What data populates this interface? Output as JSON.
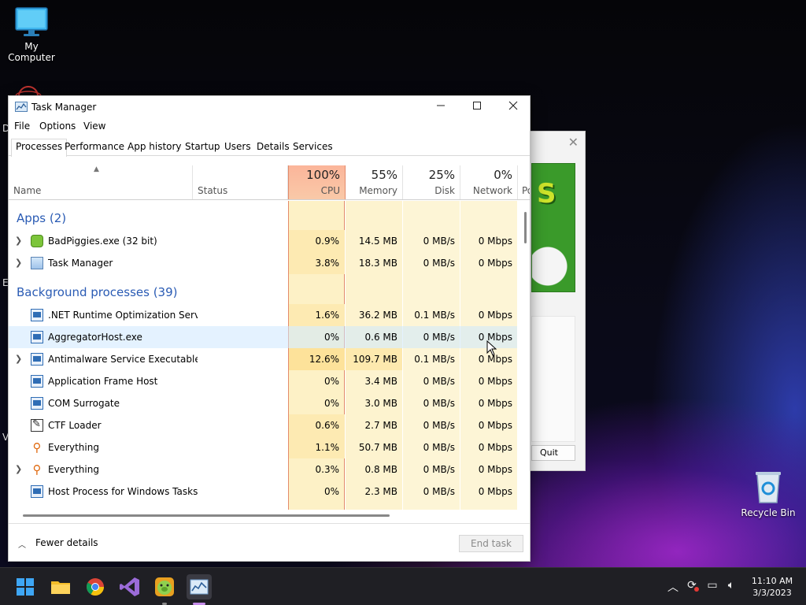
{
  "desktop": {
    "icons": {
      "my_computer": "My Computer",
      "recycle_bin": "Recycle Bin"
    },
    "partial_letters": {
      "d": "D",
      "e": "E",
      "v": "V"
    }
  },
  "background_dialog": {
    "quit_label": "Quit",
    "art_text": "S"
  },
  "window": {
    "title": "Task Manager",
    "menu": [
      "File",
      "Options",
      "View"
    ],
    "tabs": [
      "Processes",
      "Performance",
      "App history",
      "Startup",
      "Users",
      "Details",
      "Services"
    ],
    "active_tab": "Processes"
  },
  "columns": {
    "name": "Name",
    "status": "Status",
    "cpu": {
      "pct": "100%",
      "label": "CPU"
    },
    "memory": {
      "pct": "55%",
      "label": "Memory"
    },
    "disk": {
      "pct": "25%",
      "label": "Disk"
    },
    "network": {
      "pct": "0%",
      "label": "Network"
    },
    "power_partial": "Po"
  },
  "groups": {
    "apps": "Apps (2)",
    "background": "Background processes (39)"
  },
  "apps": [
    {
      "name": "BadPiggies.exe (32 bit)",
      "cpu": "0.9%",
      "memory": "14.5 MB",
      "disk": "0 MB/s",
      "network": "0 Mbps",
      "icon": "bad-piggies-icon",
      "expandable": true
    },
    {
      "name": "Task Manager",
      "cpu": "3.8%",
      "memory": "18.3 MB",
      "disk": "0 MB/s",
      "network": "0 Mbps",
      "icon": "task-manager-icon",
      "expandable": true
    }
  ],
  "background": [
    {
      "name": ".NET Runtime Optimization Serv...",
      "cpu": "1.6%",
      "memory": "36.2 MB",
      "disk": "0.1 MB/s",
      "network": "0 Mbps",
      "icon": "app-window-icon",
      "expandable": false
    },
    {
      "name": "AggregatorHost.exe",
      "cpu": "0%",
      "memory": "0.6 MB",
      "disk": "0 MB/s",
      "network": "0 Mbps",
      "icon": "app-window-icon",
      "expandable": false
    },
    {
      "name": "Antimalware Service Executable",
      "cpu": "12.6%",
      "memory": "109.7 MB",
      "disk": "0.1 MB/s",
      "network": "0 Mbps",
      "icon": "app-window-icon",
      "expandable": true
    },
    {
      "name": "Application Frame Host",
      "cpu": "0%",
      "memory": "3.4 MB",
      "disk": "0 MB/s",
      "network": "0 Mbps",
      "icon": "app-window-icon",
      "expandable": false
    },
    {
      "name": "COM Surrogate",
      "cpu": "0%",
      "memory": "3.0 MB",
      "disk": "0 MB/s",
      "network": "0 Mbps",
      "icon": "app-window-icon",
      "expandable": false
    },
    {
      "name": "CTF Loader",
      "cpu": "0.6%",
      "memory": "2.7 MB",
      "disk": "0 MB/s",
      "network": "0 Mbps",
      "icon": "ctf-loader-icon",
      "expandable": false
    },
    {
      "name": "Everything",
      "cpu": "1.1%",
      "memory": "50.7 MB",
      "disk": "0 MB/s",
      "network": "0 Mbps",
      "icon": "everything-search-icon",
      "expandable": false
    },
    {
      "name": "Everything",
      "cpu": "0.3%",
      "memory": "0.8 MB",
      "disk": "0 MB/s",
      "network": "0 Mbps",
      "icon": "everything-search-icon",
      "expandable": true
    },
    {
      "name": "Host Process for Windows Tasks",
      "cpu": "0%",
      "memory": "2.3 MB",
      "disk": "0 MB/s",
      "network": "0 Mbps",
      "icon": "app-window-icon",
      "expandable": false
    }
  ],
  "footer": {
    "fewer_details": "Fewer details",
    "end_task": "End task"
  },
  "taskbar": {
    "apps": [
      "start-icon",
      "file-explorer-icon",
      "chrome-icon",
      "visual-studio-icon",
      "bad-piggies-icon",
      "task-manager-icon"
    ],
    "clock": {
      "time": "11:10 AM",
      "date": "3/3/2023"
    }
  },
  "colors": {
    "accent_group": "#2a5bb4",
    "cpu_header": "#fbb59a",
    "heat_low": "#fdf1c6",
    "heat_high": "#fde29a"
  }
}
